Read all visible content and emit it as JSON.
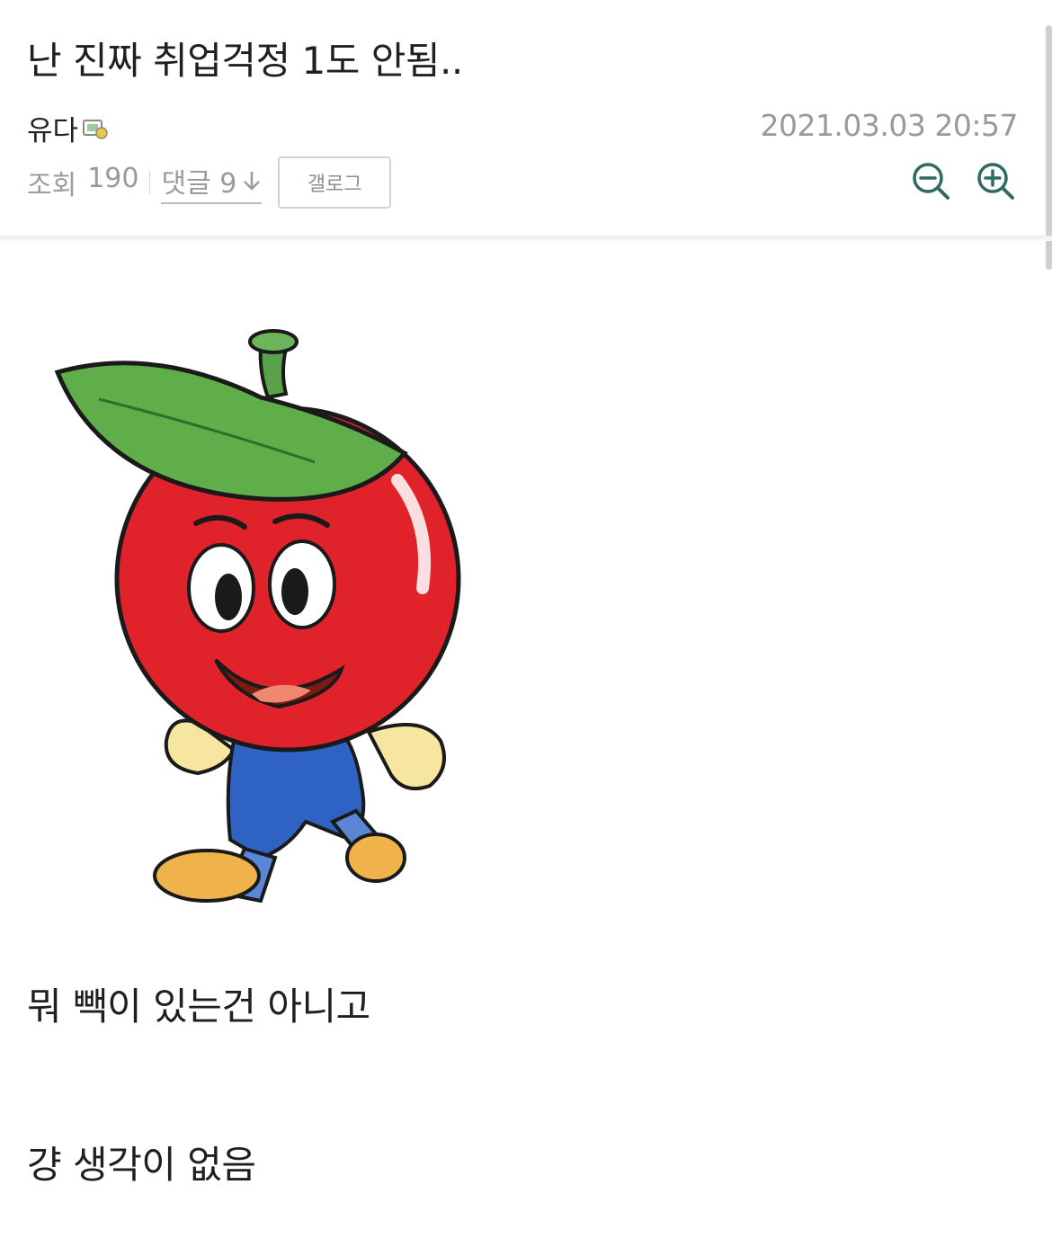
{
  "post": {
    "title": "난 진짜 취업걱정 1도 안됨..",
    "author": "유다",
    "date": "2021.03.03 20:57",
    "views_label": "조회",
    "views_count": "190",
    "comments_label": "댓글 9",
    "gallery_label": "갤로그"
  },
  "body": {
    "lines": [
      "뭐 빽이 있는건 아니고",
      "걍 생각이 없음"
    ]
  },
  "icons": {
    "badge": "cafe-member-icon",
    "comments_arrow": "down-arrow-icon",
    "zoom_out": "zoom-out-icon",
    "zoom_in": "zoom-in-icon"
  },
  "colors": {
    "accent_green": "#2f6b5f",
    "date_gray": "#9a9a9a"
  }
}
